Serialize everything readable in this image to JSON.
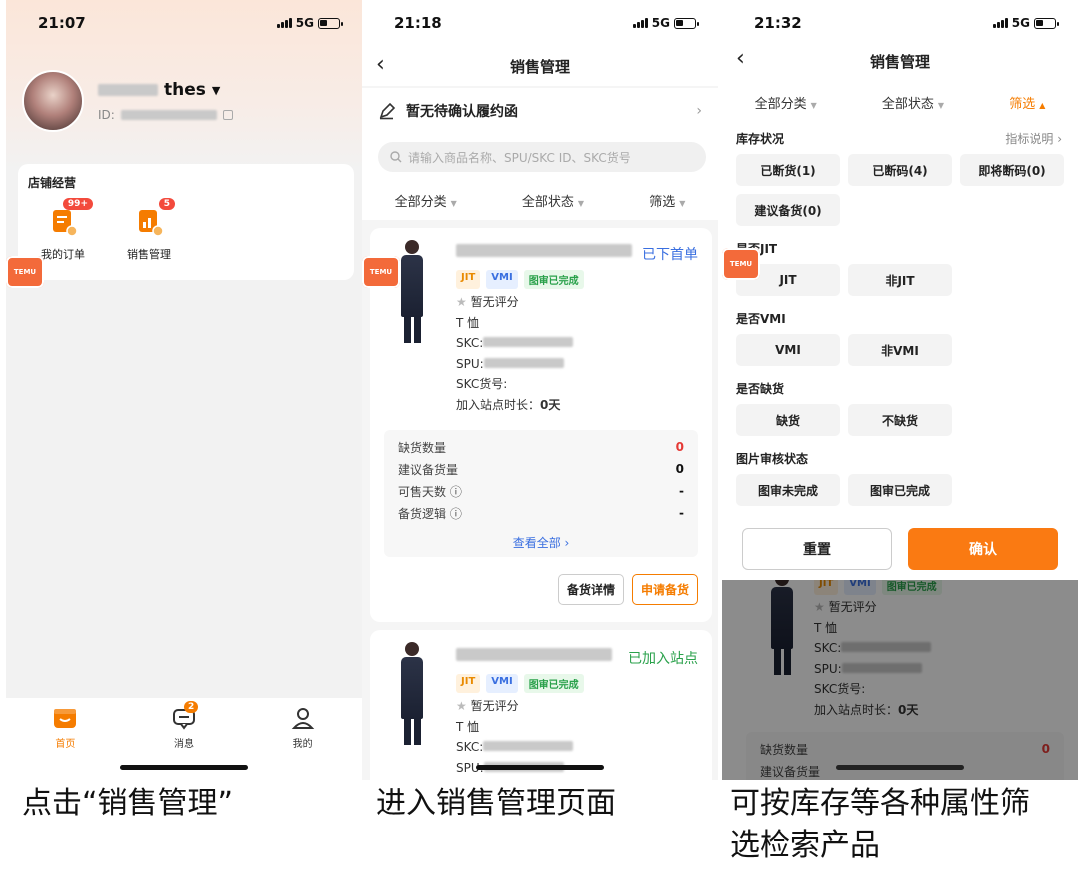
{
  "phone1": {
    "time": "21:07",
    "network": "5G",
    "shop_name_suffix": "thes",
    "id_label": "ID:",
    "section_title": "店铺经营",
    "items": [
      {
        "label": "我的订单",
        "badge": "99+"
      },
      {
        "label": "销售管理",
        "badge": "5"
      }
    ],
    "tabs": [
      {
        "label": "首页",
        "active": true
      },
      {
        "label": "消息",
        "badge": "2"
      },
      {
        "label": "我的"
      }
    ],
    "caption": "点击“销售管理”"
  },
  "phone2": {
    "time": "21:18",
    "network": "5G",
    "title": "销售管理",
    "notice": "暂无待确认履约函",
    "search_placeholder": "请输入商品名称、SPU/SKC ID、SKC货号",
    "filters": [
      "全部分类",
      "全部状态",
      "筛选"
    ],
    "products": [
      {
        "status": "已下首单",
        "status_color": "#3a6fe0",
        "tags": [
          "JIT",
          "VMI",
          "图审已完成"
        ],
        "rating": "暂无评分",
        "category": "T 恤",
        "skc_label": "SKC:",
        "spu_label": "SPU:",
        "skc_no_label": "SKC货号:",
        "duration_label": "加入站点时长：",
        "duration_value": "0天",
        "stock": [
          {
            "label": "缺货数量",
            "value": "0",
            "red": true
          },
          {
            "label": "建议备货量",
            "value": "0"
          },
          {
            "label": "可售天数 ⓘ",
            "value": "-"
          },
          {
            "label": "备货逻辑 ⓘ",
            "value": "-"
          }
        ],
        "view_all": "查看全部 ›",
        "buttons": [
          "备货详情",
          "申请备货"
        ]
      },
      {
        "status": "已加入站点",
        "status_color": "#2aa14b",
        "tags": [
          "JIT",
          "VMI",
          "图审已完成"
        ],
        "rating": "暂无评分",
        "category": "T 恤",
        "skc_label": "SKC:",
        "spu_label": "SPU:"
      }
    ],
    "caption": "进入销售管理页面"
  },
  "phone3": {
    "time": "21:32",
    "network": "5G",
    "title": "销售管理",
    "filters": [
      "全部分类",
      "全部状态",
      "筛选"
    ],
    "sections": [
      {
        "title": "库存状况",
        "link": "指标说明 ›",
        "options": [
          "已断货(1)",
          "已断码(4)",
          "即将断码(0)",
          "建议备货(0)"
        ]
      },
      {
        "title": "是否JIT",
        "options": [
          "JIT",
          "非JIT"
        ]
      },
      {
        "title": "是否VMI",
        "options": [
          "VMI",
          "非VMI"
        ]
      },
      {
        "title": "是否缺货",
        "options": [
          "缺货",
          "不缺货"
        ]
      },
      {
        "title": "图片审核状态",
        "options": [
          "图审未完成",
          "图审已完成"
        ]
      }
    ],
    "reset": "重置",
    "confirm": "确认",
    "under": {
      "tags": [
        "JIT",
        "VMI",
        "图审已完成"
      ],
      "rating": "暂无评分",
      "category": "T 恤",
      "skc_label": "SKC:",
      "spu_label": "SPU:",
      "skc_no_label": "SKC货号:",
      "duration_label": "加入站点时长：",
      "duration_value": "0天",
      "stock_label": "缺货数量",
      "stock_value": "0",
      "stock2_label": "建议备货量"
    },
    "caption_line1": "可按库存等各种属性筛",
    "caption_line2": "选检索产品"
  },
  "colors": {
    "accent": "#fa7a12",
    "blue": "#3a6fe0",
    "green": "#2aa14b",
    "red": "#e53935"
  }
}
